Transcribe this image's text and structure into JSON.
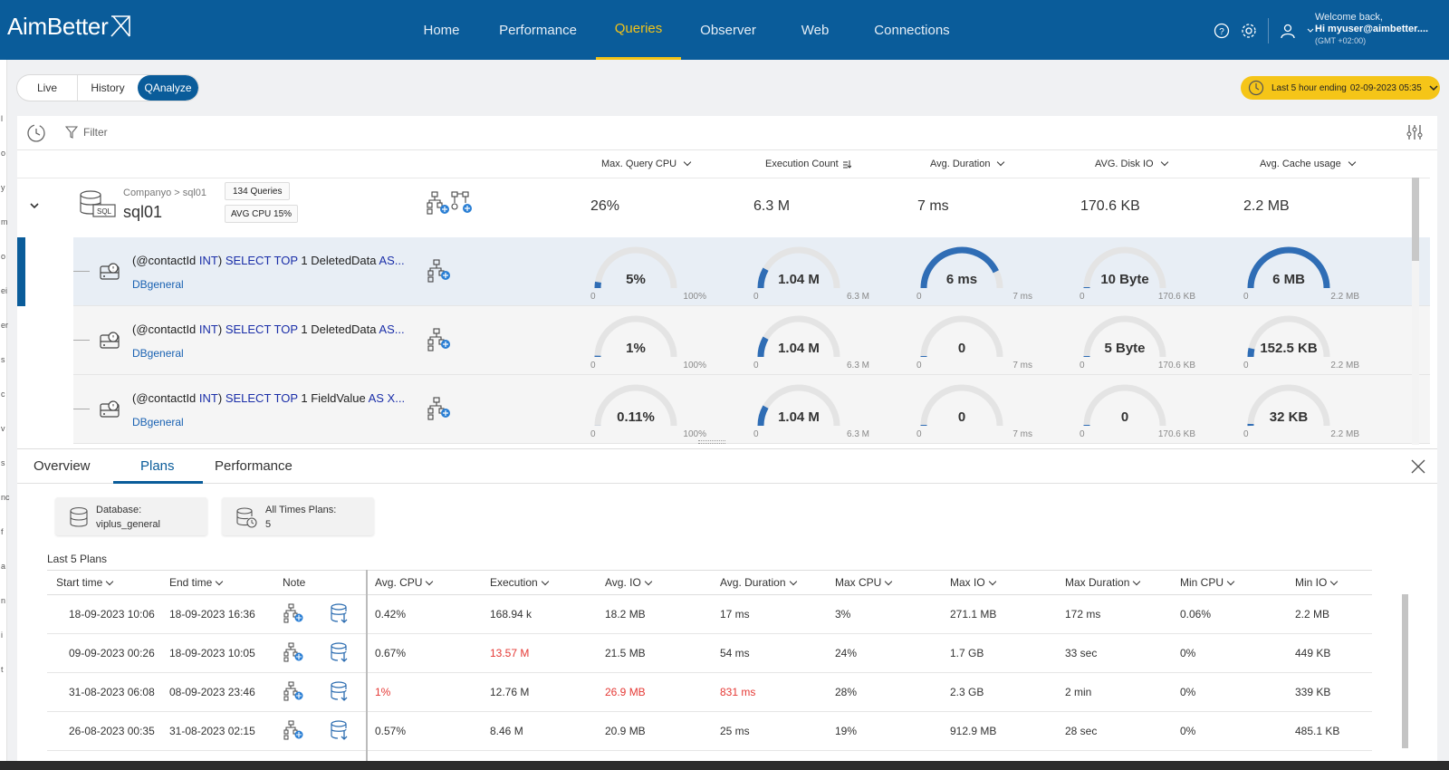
{
  "app": {
    "logo": "AimBetter"
  },
  "nav": {
    "items": [
      "Home",
      "Performance",
      "Queries",
      "Observer",
      "Web",
      "Connections"
    ],
    "active": "Queries"
  },
  "user": {
    "welcome": "Welcome back,",
    "name": "Hi myuser@aimbetter....",
    "tz": "(GMT +02:00)"
  },
  "tabs": {
    "live": "Live",
    "history": "History",
    "qanalyze": "QAnalyze"
  },
  "time_range": {
    "label": "Last 5 hour ending",
    "value": "02-09-2023 05:35"
  },
  "filter": {
    "label": "Filter"
  },
  "columns": {
    "max_query_cpu": "Max. Query CPU",
    "execution_count": "Execution Count",
    "avg_duration": "Avg. Duration",
    "avg_disk_io": "AVG. Disk IO",
    "avg_cache_usage": "Avg. Cache usage"
  },
  "server": {
    "breadcrumb": "Companyo > sql01",
    "name": "sql01",
    "queries_badge": "134 Queries",
    "cpu_badge": "AVG CPU 15%",
    "icon_label": "SQL",
    "max_query_cpu": "26%",
    "execution_count": "6.3 M",
    "avg_duration": "7 ms",
    "avg_disk_io": "170.6 KB",
    "avg_cache_usage": "2.2 MB"
  },
  "queries": [
    {
      "param": "(@contactId ",
      "type": "INT",
      "close": ") ",
      "select": "SELECT TOP",
      " num": "",
      "num": " 1 DeletedData ",
      "as": "AS...",
      "db": "DBgeneral",
      "gauges": [
        {
          "val": "5%",
          "min": "0",
          "max": "100%",
          "level": 0.05
        },
        {
          "val": "1.04 M",
          "min": "0",
          "max": "6.3 M",
          "level": 0.165
        },
        {
          "val": "6 ms",
          "min": "0",
          "max": "7 ms",
          "level": 0.857
        },
        {
          "val": "10 Byte",
          "min": "0",
          "max": "170.6 KB",
          "level": 0.0
        },
        {
          "val": "6 MB",
          "min": "0",
          "max": "2.2 MB",
          "level": 1.0
        }
      ]
    },
    {
      "param": "(@contactId ",
      "type": "INT",
      "close": ") ",
      "select": "SELECT TOP",
      "num": " 1 DeletedData ",
      "as": "AS...",
      "db": "DBgeneral",
      "gauges": [
        {
          "val": "1%",
          "min": "0",
          "max": "100%",
          "level": 0.01
        },
        {
          "val": "1.04 M",
          "min": "0",
          "max": "6.3 M",
          "level": 0.165
        },
        {
          "val": "0",
          "min": "0",
          "max": "7 ms",
          "level": 0.0
        },
        {
          "val": "5 Byte",
          "min": "0",
          "max": "170.6 KB",
          "level": 0.0
        },
        {
          "val": "152.5 KB",
          "min": "0",
          "max": "2.2 MB",
          "level": 0.07
        }
      ]
    },
    {
      "param": "(@contactId ",
      "type": "INT",
      "close": ") ",
      "select": "SELECT TOP",
      "num": " 1 FieldValue ",
      "as": "AS X...",
      "db": "DBgeneral",
      "gauges": [
        {
          "val": "0.11%",
          "min": "0",
          "max": "100%",
          "level": 0.001
        },
        {
          "val": "1.04 M",
          "min": "0",
          "max": "6.3 M",
          "level": 0.165
        },
        {
          "val": "0",
          "min": "0",
          "max": "7 ms",
          "level": 0.0
        },
        {
          "val": "0",
          "min": "0",
          "max": "170.6 KB",
          "level": 0.0
        },
        {
          "val": "32 KB",
          "min": "0",
          "max": "2.2 MB",
          "level": 0.015
        }
      ]
    }
  ],
  "bottom_tabs": {
    "overview": "Overview",
    "plans": "Plans",
    "performance": "Performance"
  },
  "cards": {
    "database_label": "Database:",
    "database_value": "viplus_general",
    "plans_label": "All Times Plans:",
    "plans_value": "5"
  },
  "plans_title": "Last 5 Plans",
  "plans_headers": [
    "Start time",
    "End time",
    "Note",
    "",
    "Avg. CPU",
    "Execution",
    "Avg. IO",
    "Avg. Duration",
    "Max CPU",
    "Max IO",
    "Max Duration",
    "Min CPU",
    "Min IO"
  ],
  "plans_rows": [
    [
      "18-09-2023 10:06",
      "18-09-2023 16:36",
      "0.42%",
      "168.94 k",
      "18.2 MB",
      "17 ms",
      "3%",
      "271.1 MB",
      "172 ms",
      "0.06%",
      "2.2 MB"
    ],
    [
      "09-09-2023 00:26",
      "18-09-2023 10:05",
      "0.67%",
      "13.57 M",
      "21.5 MB",
      "54 ms",
      "24%",
      "1.7 GB",
      "33 sec",
      "0%",
      "449 KB"
    ],
    [
      "31-08-2023 06:08",
      "08-09-2023 23:46",
      "1%",
      "12.76 M",
      "26.9 MB",
      "831 ms",
      "28%",
      "2.3 GB",
      "2 min",
      "0%",
      "339 KB"
    ],
    [
      "26-08-2023 00:35",
      "31-08-2023 02:15",
      "0.57%",
      "8.46 M",
      "20.9 MB",
      "25 ms",
      "19%",
      "912.9 MB",
      "28 sec",
      "0%",
      "485.1 KB"
    ]
  ],
  "left_strip": [
    "l",
    "o",
    "y",
    "m",
    "o",
    "ei",
    "er",
    "s",
    "c",
    "v",
    "s",
    "nc",
    "f",
    "a",
    "n",
    "i",
    "t"
  ]
}
